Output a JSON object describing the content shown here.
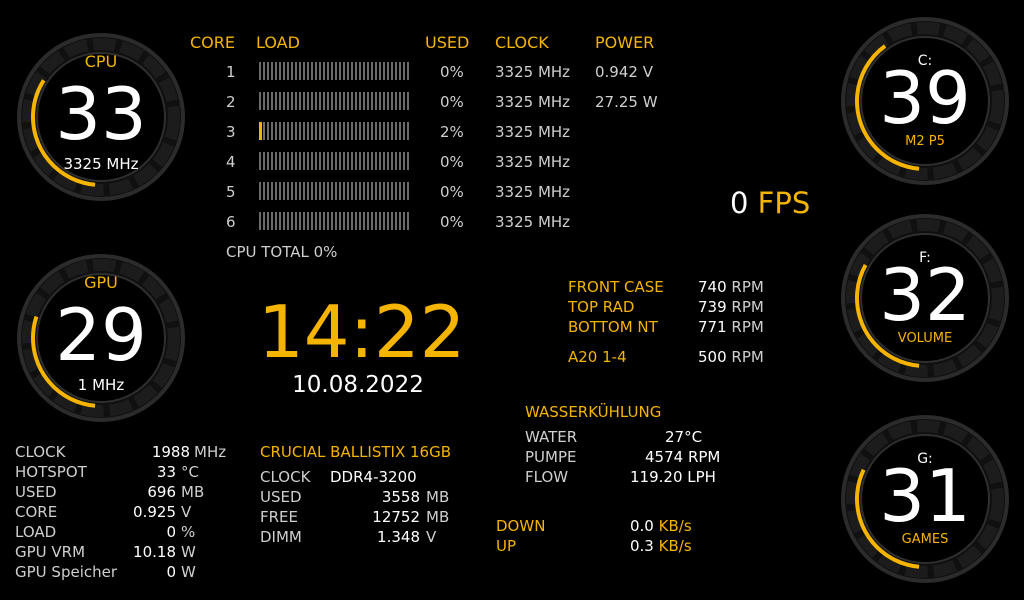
{
  "cpu_gauge": {
    "label": "CPU",
    "value": "33",
    "sub": "3325 MHz",
    "level": 0.33
  },
  "gpu_gauge": {
    "label": "GPU",
    "value": "29",
    "sub": "1 MHz",
    "level": 0.29
  },
  "drives": [
    {
      "label": "C:",
      "value": "39",
      "name": "M2 P5",
      "level": 0.39
    },
    {
      "label": "F:",
      "value": "32",
      "name": "VOLUME",
      "level": 0.32
    },
    {
      "label": "G:",
      "value": "31",
      "name": "GAMES",
      "level": 0.31
    }
  ],
  "cpu_table": {
    "headers": {
      "core": "CORE",
      "load": "LOAD",
      "used": "USED",
      "clock": "CLOCK",
      "power": "POWER"
    },
    "rows": [
      {
        "core": "1",
        "used": "0%",
        "clock": "3325 MHz",
        "load": 0
      },
      {
        "core": "2",
        "used": "0%",
        "clock": "3325 MHz",
        "load": 0
      },
      {
        "core": "3",
        "used": "2%",
        "clock": "3325 MHz",
        "load": 0.02
      },
      {
        "core": "4",
        "used": "0%",
        "clock": "3325 MHz",
        "load": 0
      },
      {
        "core": "5",
        "used": "0%",
        "clock": "3325 MHz",
        "load": 0
      },
      {
        "core": "6",
        "used": "0%",
        "clock": "3325 MHz",
        "load": 0
      }
    ],
    "power": [
      "0.942 V",
      "27.25 W"
    ],
    "total": "CPU TOTAL 0%"
  },
  "fps": {
    "value": "0",
    "unit": "FPS"
  },
  "time": "14:22",
  "date": "10.08.2022",
  "fans": [
    {
      "name": "FRONT CASE",
      "value": "740",
      "unit": "RPM"
    },
    {
      "name": "TOP RAD",
      "value": "739",
      "unit": "RPM"
    },
    {
      "name": "BOTTOM NT",
      "value": "771",
      "unit": "RPM"
    },
    {
      "name": "A20 1-4",
      "value": "500",
      "unit": "RPM"
    }
  ],
  "water": {
    "title": "WASSERKÜHLUNG",
    "rows": [
      {
        "name": "WATER",
        "value": "27°C"
      },
      {
        "name": "PUMPE",
        "value": "4574 RPM"
      },
      {
        "name": "FLOW",
        "value": "119.20 LPH"
      }
    ]
  },
  "network": [
    {
      "name": "DOWN",
      "value": "0.0",
      "unit": "KB/s"
    },
    {
      "name": "UP",
      "value": "0.3",
      "unit": "KB/s"
    }
  ],
  "gpu_stats": [
    {
      "name": "CLOCK",
      "value": "1988",
      "unit": "MHz"
    },
    {
      "name": "HOTSPOT",
      "value": "33",
      "unit": "°C"
    },
    {
      "name": "USED",
      "value": "696",
      "unit": "MB"
    },
    {
      "name": "CORE",
      "value": "0.925",
      "unit": "V"
    },
    {
      "name": "LOAD",
      "value": "0",
      "unit": "%"
    },
    {
      "name": "GPU VRM",
      "value": "10.18",
      "unit": "W"
    },
    {
      "name": "GPU Speicher",
      "value": "0",
      "unit": "W"
    }
  ],
  "ram": {
    "title": "CRUCIAL BALLISTIX 16GB",
    "rows": [
      {
        "name": "CLOCK",
        "value": "DDR4-3200",
        "unit": ""
      },
      {
        "name": "USED",
        "value": "3558",
        "unit": "MB"
      },
      {
        "name": "FREE",
        "value": "12752",
        "unit": "MB"
      },
      {
        "name": "DIMM",
        "value": "1.348",
        "unit": "V"
      }
    ]
  },
  "colors": {
    "accent": "#f5b400",
    "text": "#d6d6d6",
    "ring": "#2a2a2a"
  }
}
